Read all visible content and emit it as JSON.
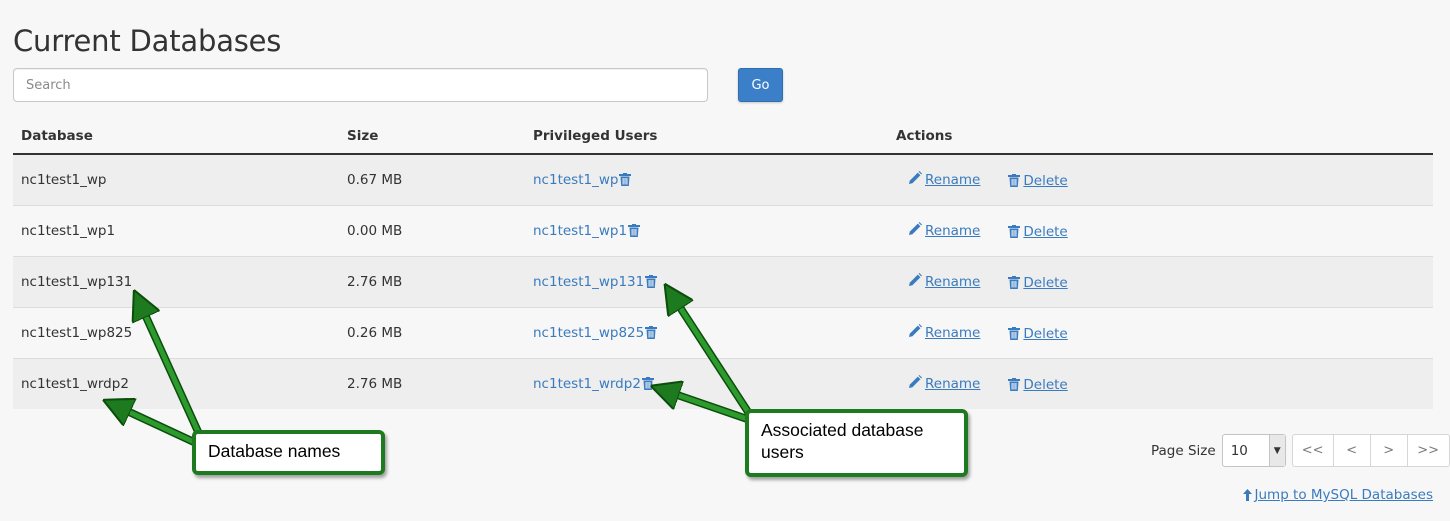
{
  "page": {
    "title": "Current Databases"
  },
  "search": {
    "placeholder": "Search",
    "value": "",
    "go_label": "Go"
  },
  "table": {
    "headers": {
      "database": "Database",
      "size": "Size",
      "users": "Privileged Users",
      "actions": "Actions"
    },
    "rows": [
      {
        "database": "nc1test1_wp",
        "size": "0.67 MB",
        "user": "nc1test1_wp"
      },
      {
        "database": "nc1test1_wp1",
        "size": "0.00 MB",
        "user": "nc1test1_wp1"
      },
      {
        "database": "nc1test1_wp131",
        "size": "2.76 MB",
        "user": "nc1test1_wp131"
      },
      {
        "database": "nc1test1_wp825",
        "size": "0.26 MB",
        "user": "nc1test1_wp825"
      },
      {
        "database": "nc1test1_wrdp2",
        "size": "2.76 MB",
        "user": "nc1test1_wrdp2"
      }
    ],
    "rename_label": "Rename",
    "delete_label": "Delete"
  },
  "pagination": {
    "page_size_label": "Page Size",
    "page_size_value": "10",
    "first": "<<",
    "prev": "<",
    "next": ">",
    "last": ">>"
  },
  "jump_link": "Jump to MySQL Databases",
  "annotations": {
    "db_names": "Database names",
    "db_users": "Associated database users"
  },
  "colors": {
    "link": "#3a7bbf",
    "go_button": "#3b7fc9",
    "annotation_green": "#1e7a1e"
  },
  "icons": [
    "trash-icon",
    "pencil-icon",
    "arrow-up-icon",
    "chevron-down-icon"
  ]
}
